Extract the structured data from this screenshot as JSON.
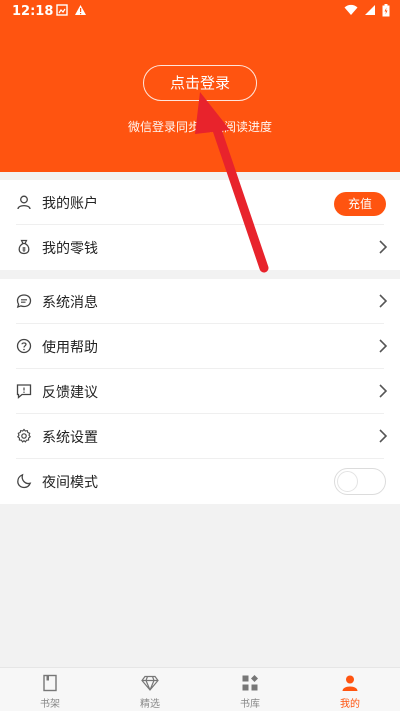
{
  "status_bar": {
    "time": "12:18"
  },
  "header": {
    "login_button": "点击登录",
    "login_hint": "微信登录同步云端阅读进度"
  },
  "account": {
    "my_account": "我的账户",
    "recharge": "充值",
    "my_change": "我的零钱"
  },
  "menu": {
    "system_messages": "系统消息",
    "help": "使用帮助",
    "feedback": "反馈建议",
    "settings": "系统设置",
    "night_mode": "夜间模式"
  },
  "tabs": [
    {
      "label": "书架",
      "icon": "bookshelf-icon",
      "active": false
    },
    {
      "label": "精选",
      "icon": "diamond-icon",
      "active": false
    },
    {
      "label": "书库",
      "icon": "library-grid-icon",
      "active": false
    },
    {
      "label": "我的",
      "icon": "person-icon",
      "active": true
    }
  ],
  "colors": {
    "accent": "#ff5410",
    "annotation_arrow": "#e8232c"
  }
}
